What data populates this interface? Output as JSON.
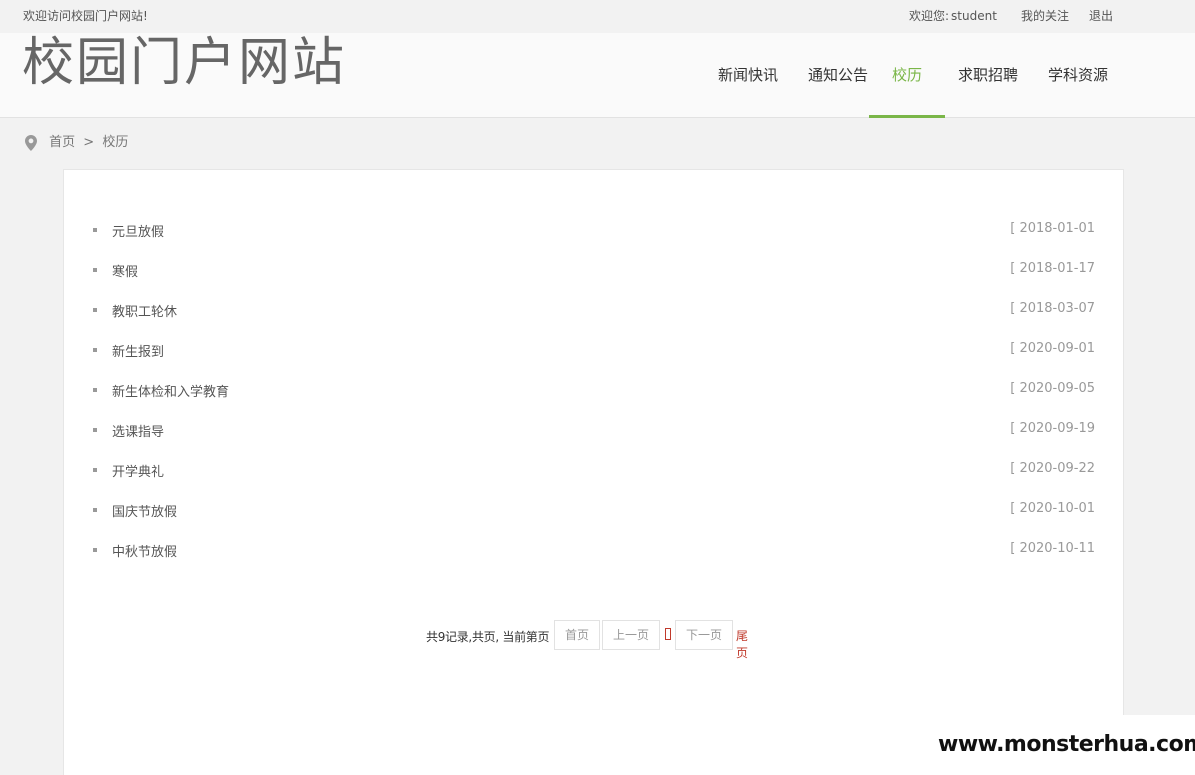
{
  "topbar": {
    "welcome": "欢迎访问校园门户网站!",
    "user_prefix": "欢迎您:",
    "user_name": "student",
    "favorites": "我的关注",
    "logout": "退出"
  },
  "header": {
    "site_title": "校园门户网站",
    "nav": [
      {
        "label": "新闻快讯"
      },
      {
        "label": "通知公告"
      },
      {
        "label": "校历",
        "active": true
      },
      {
        "label": "求职招聘"
      },
      {
        "label": "学科资源"
      }
    ]
  },
  "breadcrumb": {
    "home": "首页",
    "separator": ">",
    "current": "校历"
  },
  "calendar": {
    "items": [
      {
        "title": "元旦放假",
        "date": "[ 2018-01-01"
      },
      {
        "title": "寒假",
        "date": "[ 2018-01-17"
      },
      {
        "title": "教职工轮休",
        "date": "[ 2018-03-07"
      },
      {
        "title": "新生报到",
        "date": "[ 2020-09-01"
      },
      {
        "title": "新生体检和入学教育",
        "date": "[ 2020-09-05"
      },
      {
        "title": "选课指导",
        "date": "[ 2020-09-19"
      },
      {
        "title": "开学典礼",
        "date": "[ 2020-09-22"
      },
      {
        "title": "国庆节放假",
        "date": "[ 2020-10-01"
      },
      {
        "title": "中秋节放假",
        "date": "[ 2020-10-11"
      }
    ]
  },
  "pagination": {
    "summary": "共9记录,共页, 当前第页",
    "first": "首页",
    "prev": "上一页",
    "next": "下一页",
    "last": "尾页"
  },
  "watermark": "www.monsterhua.com",
  "colors": {
    "accent": "#7ab648",
    "pager_highlight": "#c0392b"
  }
}
